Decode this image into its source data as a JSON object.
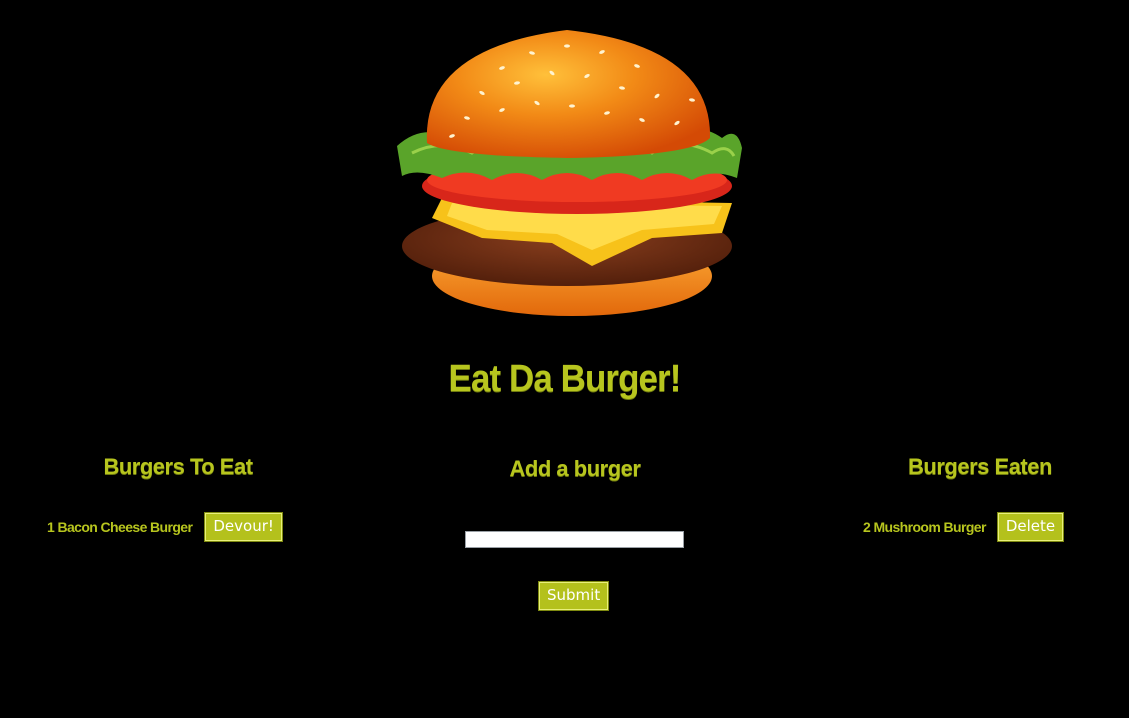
{
  "app": {
    "title": "Eat Da Burger!"
  },
  "hero": {
    "icon": "burger-illustration"
  },
  "columns": {
    "to_eat": {
      "heading": "Burgers To Eat",
      "items": [
        {
          "label": "1 Bacon Cheese Burger",
          "action": "Devour!"
        }
      ]
    },
    "add": {
      "heading": "Add a burger",
      "input_value": "",
      "submit_label": "Submit"
    },
    "eaten": {
      "heading": "Burgers Eaten",
      "items": [
        {
          "label": "2 Mushroom Burger",
          "action": "Delete"
        }
      ]
    }
  },
  "colors": {
    "background": "#000000",
    "accent": "#b7c51e"
  }
}
